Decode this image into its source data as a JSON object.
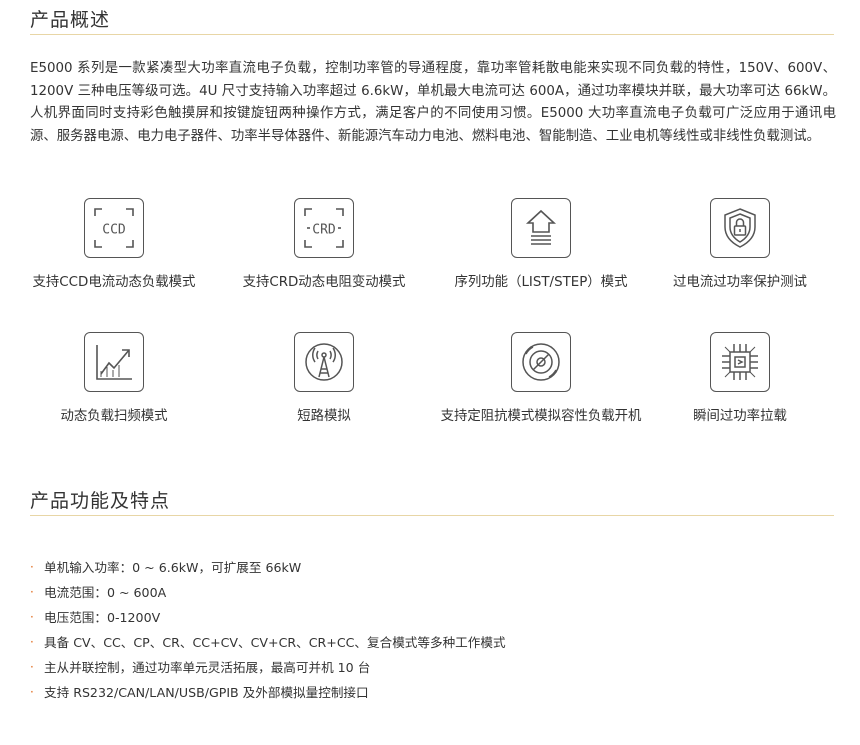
{
  "overview": {
    "title": "产品概述",
    "paragraph": "E5000 系列是一款紧凑型大功率直流电子负载，控制功率管的导通程度，靠功率管耗散电能来实现不同负载的特性，150V、600V、1200V 三种电压等级可选。4U 尺寸支持输入功率超过 6.6kW，单机最大电流可达 600A，通过功率模块并联，最大功率可达 66kW。人机界面同时支持彩色触摸屏和按键旋钮两种操作方式，满足客户的不同使用习惯。E5000 大功率直流电子负载可广泛应用于通讯电源、服务器电源、电力电子器件、功率半导体器件、新能源汽车动力电池、燃料电池、智能制造、工业电机等线性或非线性负载测试。"
  },
  "features": [
    {
      "label": "支持CCD电流动态负载模式",
      "icon": "ccd-icon",
      "icon_text": "CCD"
    },
    {
      "label": "支持CRD动态电阻变动模式",
      "icon": "crd-icon",
      "icon_text": "CRD"
    },
    {
      "label": "序列功能（LIST/STEP）模式",
      "icon": "list-step-icon"
    },
    {
      "label": "过电流过功率保护测试",
      "icon": "shield-lock-icon"
    },
    {
      "label": "动态负载扫频模式",
      "icon": "sweep-chart-icon"
    },
    {
      "label": "短路模拟",
      "icon": "tower-antenna-icon"
    },
    {
      "label": "支持定阻抗模式模拟容性负载开机",
      "icon": "disc-icon"
    },
    {
      "label": "瞬间过功率拉载",
      "icon": "chip-icon"
    }
  ],
  "specs_section": {
    "title": "产品功能及特点",
    "bullet": "·",
    "items": [
      "单机输入功率：0 ~ 6.6kW，可扩展至 66kW",
      "电流范围：0 ~ 600A",
      "电压范围：0-1200V",
      "具备 CV、CC、CP、CR、CC+CV、CV+CR、CR+CC、复合模式等多种工作模式",
      "主从并联控制，通过功率单元灵活拓展，最高可并机 10 台",
      "支持 RS232/CAN/LAN/USB/GPIB 及外部模拟量控制接口"
    ]
  },
  "colors": {
    "bullet": "#e06a1c",
    "rule": "#e8d6a6",
    "icon_stroke": "#555555"
  }
}
